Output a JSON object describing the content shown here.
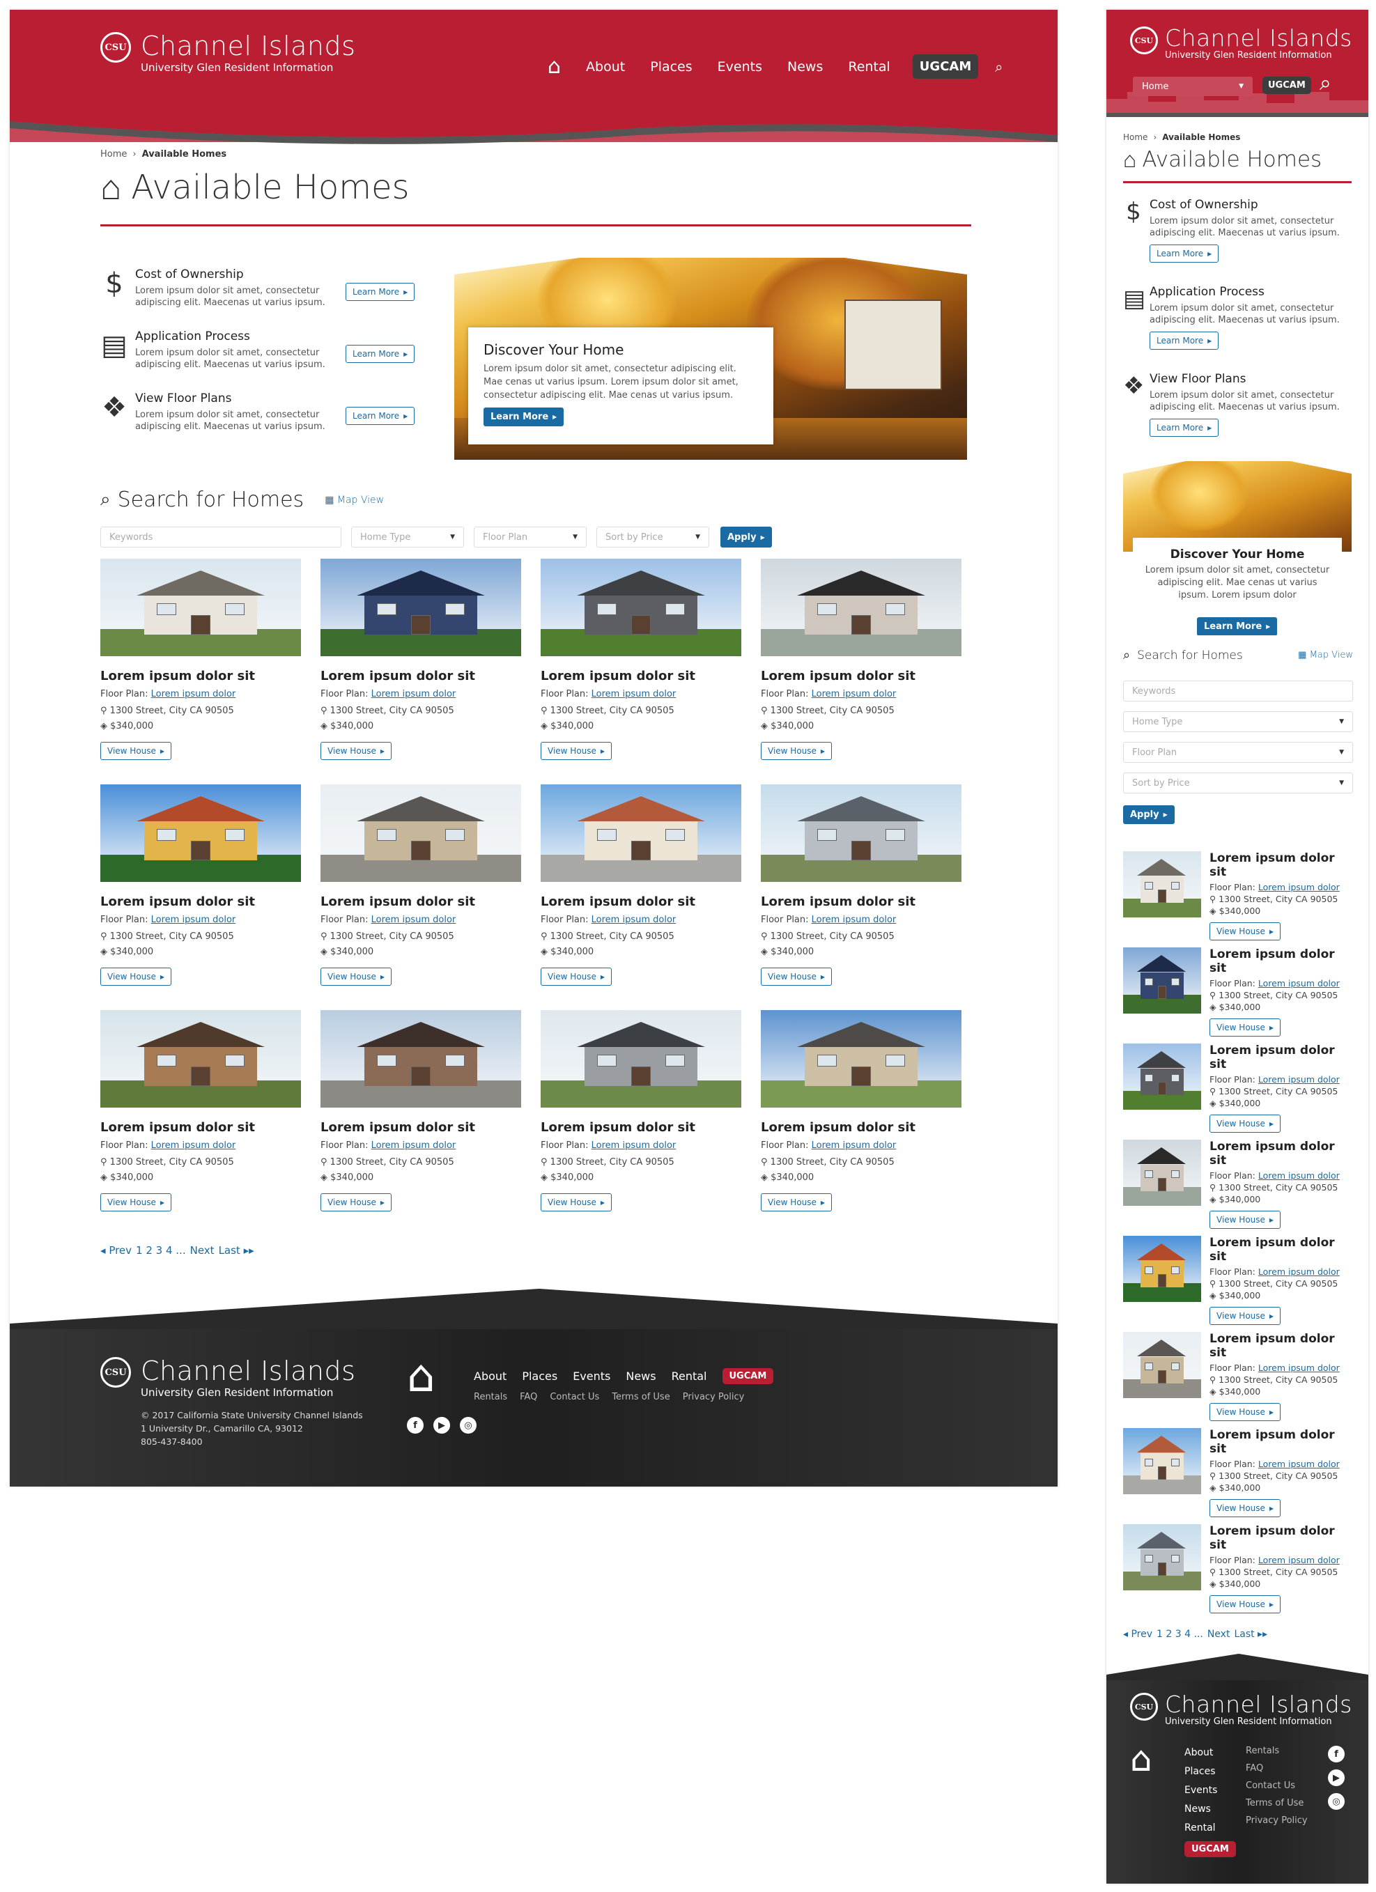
{
  "site": {
    "logo_mark": "CSU",
    "name": "Channel Islands",
    "tagline": "University Glen Resident Information",
    "nav": [
      "About",
      "Places",
      "Events",
      "News",
      "Rental"
    ],
    "nav_cta": "UGCAM",
    "colors": {
      "brand_red": "#ba1e32",
      "link_blue": "#1a6aa3",
      "footer_dark": "#2a2a2a"
    }
  },
  "mobile_nav": {
    "select_value": "Home",
    "cta": "UGCAM"
  },
  "breadcrumb": {
    "home": "Home",
    "sep": "›",
    "current": "Available Homes"
  },
  "page_title": "Available Homes",
  "features": [
    {
      "icon": "dollar-icon",
      "glyph": "$",
      "title": "Cost of Ownership",
      "text": "Lorem ipsum dolor sit amet, consectetur adipiscing elit. Maecenas ut varius ipsum.",
      "button": "Learn More"
    },
    {
      "icon": "document-icon",
      "glyph": "▤",
      "title": "Application Process",
      "text": "Lorem ipsum dolor sit amet, consectetur adipiscing elit. Maecenas ut varius ipsum.",
      "button": "Learn More"
    },
    {
      "icon": "floorplan-icon",
      "glyph": "❖",
      "title": "View Floor Plans",
      "text": "Lorem ipsum dolor sit amet, consectetur adipiscing elit. Maecenas ut varius ipsum.",
      "button": "Learn More"
    }
  ],
  "hero": {
    "title": "Discover Your Home",
    "text": "Lorem ipsum dolor sit amet, consectetur adipiscing elit. Mae cenas ut varius ipsum. Lorem ipsum dolor sit amet, consectetur adipiscing elit. Mae cenas ut varius ipsum.",
    "mobile_text": "Lorem ipsum dolor sit amet, consectetur adipiscing elit. Mae cenas ut varius ipsum. Lorem ipsum dolor",
    "button": "Learn More"
  },
  "search": {
    "title": "Search for Homes",
    "map_view": "Map View",
    "keywords_placeholder": "Keywords",
    "home_type": "Home Type",
    "floor_plan": "Floor Plan",
    "sort": "Sort by Price",
    "apply": "Apply"
  },
  "listing": {
    "title": "Lorem ipsum dolor sit",
    "floor_plan_label": "Floor Plan:",
    "floor_plan_link": "Lorem ipsum dolor",
    "address": "1300 Street, City CA 90505",
    "price": "$340,000",
    "button": "View House"
  },
  "pagination": {
    "prev": "Prev",
    "pages": "1 2 3 4 ...",
    "next": "Next",
    "last": "Last"
  },
  "footer": {
    "copyright": "© 2017 California State University Channel Islands",
    "address": "1 University Dr., Camarillo CA, 93012",
    "phone": "805-437-8400",
    "links": [
      "Rentals",
      "FAQ",
      "Contact Us",
      "Terms of Use",
      "Privacy Policy"
    ],
    "social": [
      "f",
      "▶",
      "◎"
    ]
  }
}
